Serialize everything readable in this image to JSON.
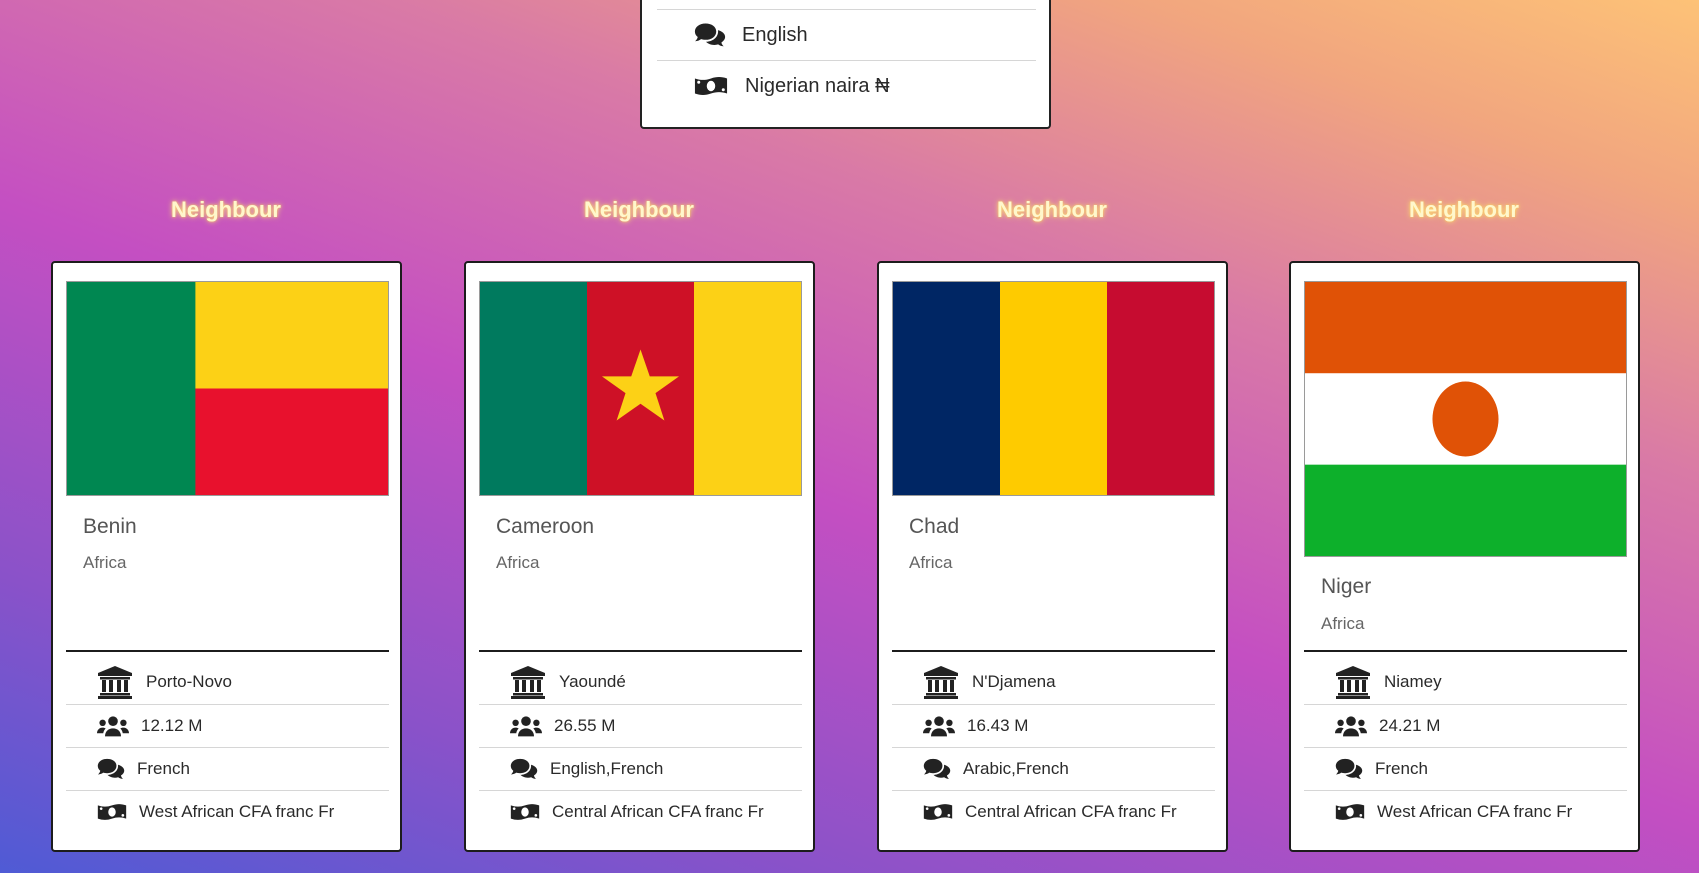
{
  "main_country": {
    "language": "English",
    "currency": "Nigerian naira ₦"
  },
  "neighbour_heading": "Neighbour",
  "neighbours": [
    {
      "name": "Benin",
      "region": "Africa",
      "capital": "Porto-Novo",
      "population": "12.12 M",
      "languages": "French",
      "currency": "West African CFA franc Fr",
      "flag": "benin",
      "colors": [
        "#008751",
        "#FCD116",
        "#E8112D"
      ]
    },
    {
      "name": "Cameroon",
      "region": "Africa",
      "capital": "Yaoundé",
      "population": "26.55 M",
      "languages": "English,French",
      "currency": "Central African CFA franc Fr",
      "flag": "cameroon",
      "colors": [
        "#007A5E",
        "#CE1126",
        "#FCD116"
      ]
    },
    {
      "name": "Chad",
      "region": "Africa",
      "capital": "N'Djamena",
      "population": "16.43 M",
      "languages": "Arabic,French",
      "currency": "Central African CFA franc Fr",
      "flag": "chad",
      "colors": [
        "#002664",
        "#FECB00",
        "#C60C30"
      ]
    },
    {
      "name": "Niger",
      "region": "Africa",
      "capital": "Niamey",
      "population": "24.21 M",
      "languages": "French",
      "currency": "West African CFA franc Fr",
      "flag": "niger",
      "colors": [
        "#E05206",
        "#FFFFFF",
        "#0DB02B"
      ]
    }
  ],
  "icons": [
    "capital-icon",
    "population-icon",
    "language-icon",
    "currency-icon"
  ]
}
